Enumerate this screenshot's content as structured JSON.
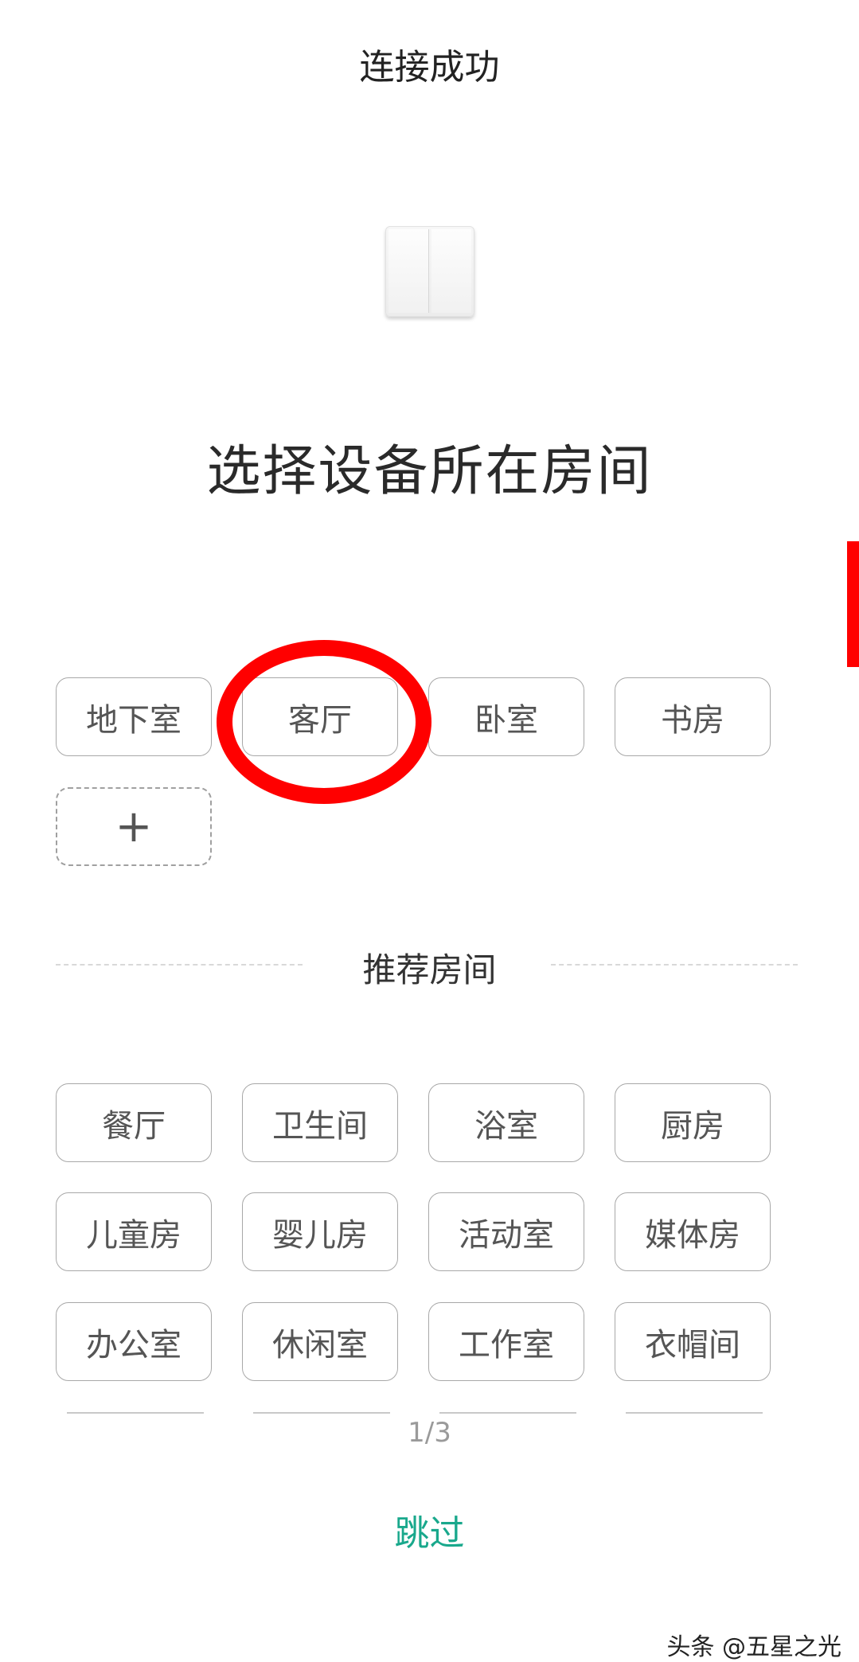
{
  "header": {
    "title": "连接成功"
  },
  "device": {
    "image": "double-wall-switch"
  },
  "prompt": {
    "heading": "选择设备所在房间"
  },
  "rooms": {
    "items": [
      "地下室",
      "客厅",
      "卧室",
      "书房"
    ],
    "add_icon": "+",
    "highlighted": "客厅"
  },
  "recommended": {
    "title": "推荐房间",
    "items": [
      "餐厅",
      "卫生间",
      "浴室",
      "厨房",
      "儿童房",
      "婴儿房",
      "活动室",
      "媒体房",
      "办公室",
      "休闲室",
      "工作室",
      "衣帽间"
    ],
    "page_indicator": "1/3"
  },
  "footer": {
    "skip": "跳过"
  },
  "watermark": {
    "text": "头条 @五星之光"
  },
  "colors": {
    "accent": "#19a88c",
    "annotation": "#ff0000"
  }
}
